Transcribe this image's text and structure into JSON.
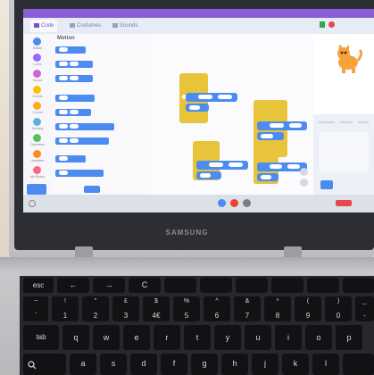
{
  "brand": "SAMSUNG",
  "scratch": {
    "tabs": [
      "Code",
      "Costumes",
      "Sounds"
    ],
    "palette_title": "Motion",
    "categories": [
      "Motion",
      "Looks",
      "Sound",
      "Events",
      "Control",
      "Sensing",
      "Operators",
      "Variables",
      "My Blocks"
    ]
  },
  "keyboard": {
    "row1": [
      "esc",
      "←",
      "→",
      "C",
      "",
      "",
      "",
      "",
      "",
      "",
      ""
    ],
    "row2": [
      {
        "top": "~",
        "bottom": "`"
      },
      {
        "top": "!",
        "bottom": "1"
      },
      {
        "top": "\"",
        "bottom": "2"
      },
      {
        "top": "£",
        "bottom": "3"
      },
      {
        "top": "$",
        "bottom": "4€"
      },
      {
        "top": "%",
        "bottom": "5"
      },
      {
        "top": "^",
        "bottom": "6"
      },
      {
        "top": "&",
        "bottom": "7"
      },
      {
        "top": "*",
        "bottom": "8"
      },
      {
        "top": "(",
        "bottom": "9"
      },
      {
        "top": ")",
        "bottom": "0"
      },
      {
        "top": "_",
        "bottom": "-"
      }
    ],
    "row3": [
      "tab",
      "q",
      "w",
      "e",
      "r",
      "t",
      "y",
      "u",
      "i",
      "o",
      "p"
    ],
    "row4": [
      "",
      "a",
      "s",
      "d",
      "f",
      "g",
      "h",
      "j",
      "k",
      "l"
    ]
  },
  "colors": {
    "scratch_purple": "#8a5fd6",
    "motion_blue": "#4c8bef",
    "events_yellow": "#e8c43a",
    "key_black": "#111214"
  }
}
